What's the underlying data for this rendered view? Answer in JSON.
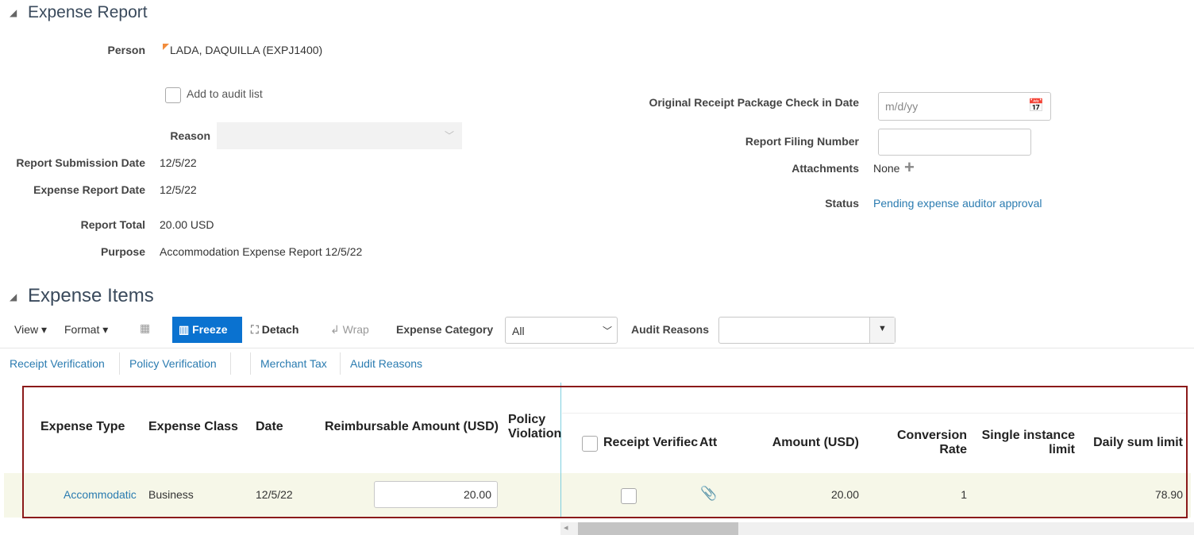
{
  "report": {
    "title": "Expense Report",
    "person_label": "Person",
    "person": "LADA, DAQUILLA (EXPJ1400)",
    "audit_checkbox": "Add to audit list",
    "reason_label": "Reason",
    "submission_label": "Report Submission Date",
    "submission": "12/5/22",
    "date_label": "Expense Report Date",
    "date": "12/5/22",
    "total_label": "Report Total",
    "total": "20.00 USD",
    "purpose_label": "Purpose",
    "purpose": "Accommodation Expense Report 12/5/22",
    "receipt_label": "Original Receipt Package Check in Date",
    "receipt_placeholder": "m/d/yy",
    "filing_label": "Report Filing Number",
    "attachments_label": "Attachments",
    "attachments": "None",
    "status_label": "Status",
    "status": "Pending expense auditor approval"
  },
  "items": {
    "title": "Expense Items",
    "view": "View",
    "format": "Format",
    "freeze": "Freeze",
    "detach": "Detach",
    "wrap": "Wrap",
    "category_label": "Expense Category",
    "category": "All",
    "audit_label": "Audit Reasons",
    "tabs": [
      "Receipt Verification",
      "Policy Verification",
      "Merchant Tax",
      "Audit Reasons"
    ],
    "columns": {
      "type": "Expense Type",
      "class": "Expense Class",
      "date": "Date",
      "reimb": "Reimbursable Amount (USD)",
      "policy1": "Policy",
      "policy2": "Violation",
      "receipt": "Receipt Verifiec",
      "att": "Att",
      "amount": "Amount (USD)",
      "conv1": "Conversion",
      "conv2": "Rate",
      "single1": "Single instance",
      "single2": "limit",
      "daily": "Daily sum limit"
    },
    "row": {
      "type": "Accommodatic",
      "class": "Business",
      "date": "12/5/22",
      "reimb": "20.00",
      "amount": "20.00",
      "conv": "1",
      "daily": "78.90"
    }
  }
}
